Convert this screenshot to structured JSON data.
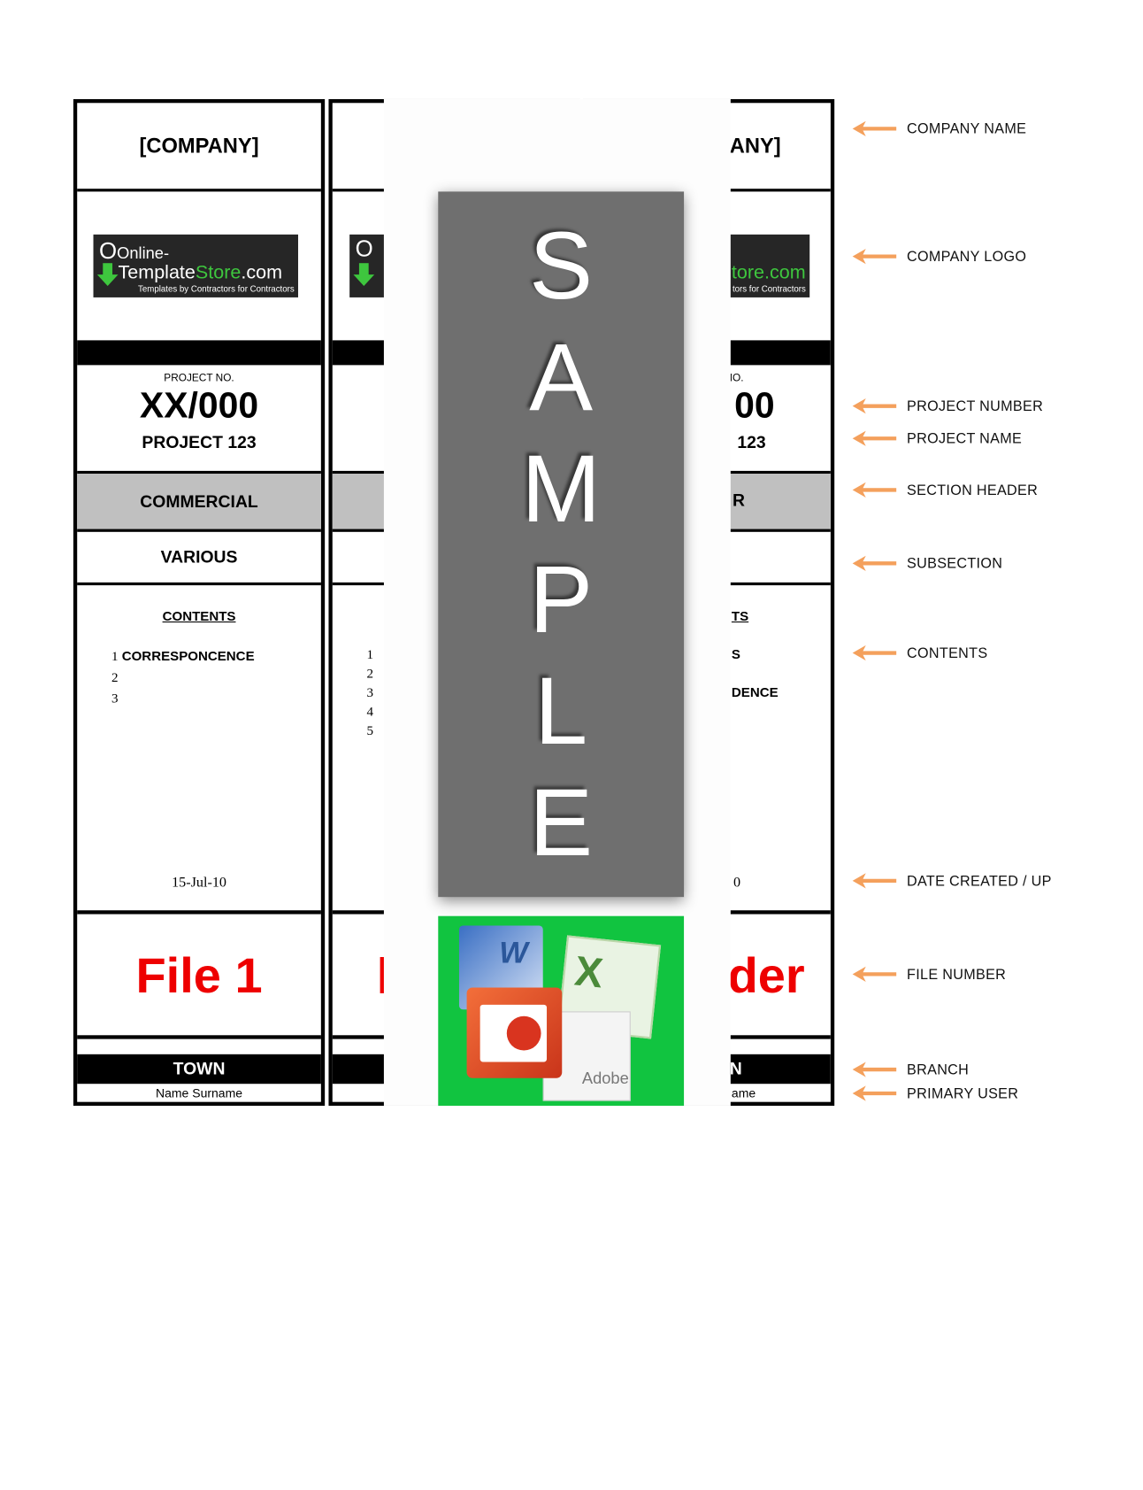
{
  "panel_1": {
    "company": "[COMPANY]",
    "logo": {
      "line1": "Online-",
      "line2a": "Template",
      "line2b": "Store",
      "line2c": ".com",
      "tagline": "Templates by Contractors for Contractors"
    },
    "project_no_label": "PROJECT NO.",
    "project_no": "XX/000",
    "project_name": "PROJECT 123",
    "section_header": "COMMERCIAL",
    "subsection": "VARIOUS",
    "contents_title": "CONTENTS",
    "contents": [
      {
        "num": "1",
        "label": "CORRESPONCENCE"
      },
      {
        "num": "2",
        "label": ""
      },
      {
        "num": "3",
        "label": ""
      }
    ],
    "date": "15-Jul-10",
    "file_number": "File 1",
    "branch": "TOWN",
    "primary_user": "Name Surname"
  },
  "panel_2": {
    "contents_numbers": [
      "1",
      "2",
      "3",
      "4",
      "5"
    ],
    "logo_fragment": "O"
  },
  "panel_3": {
    "company_fragment": "ANY]",
    "logo_fragment": "tore.com",
    "tagline_fragment": "tors for Contractors",
    "project_no_label_fragment": "IO.",
    "project_no_fragment": "00",
    "project_name_fragment": "123",
    "section_fragment": "R",
    "contents_title_fragment": "TS",
    "contents_line1_fragment": "S",
    "contents_line3_fragment": "DENCE",
    "date_fragment": "0",
    "file_fragment": "der",
    "branch_fragment": "N",
    "user_fragment": "ame"
  },
  "sample_overlay": {
    "text": "SAMPLE",
    "letters": [
      "S",
      "A",
      "M",
      "P",
      "L",
      "E"
    ],
    "badge_label": "Adobe",
    "word_letter": "W",
    "excel_letter": "X"
  },
  "annotations": [
    "COMPANY NAME",
    "COMPANY LOGO",
    "PROJECT NUMBER",
    "PROJECT NAME",
    "SECTION HEADER",
    "SUBSECTION",
    "CONTENTS",
    "DATE CREATED / UP",
    "FILE NUMBER",
    "BRANCH",
    "PRIMARY USER"
  ],
  "colors": {
    "arrow": "#f4a05c",
    "file_number": "#ee0000",
    "section_bg": "#c0c0c0",
    "overlay_gray": "#6f6f6f",
    "overlay_green": "#11c440",
    "logo_green": "#3ec63e"
  }
}
